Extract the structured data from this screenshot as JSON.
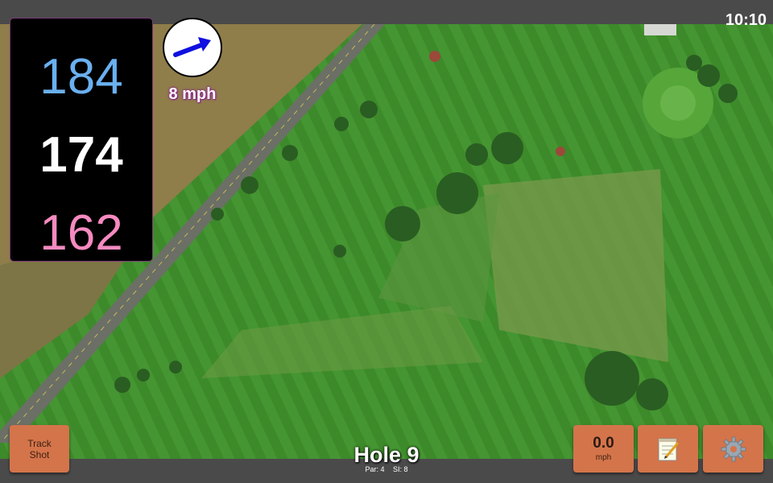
{
  "status_bar": {
    "time": "10:10"
  },
  "distances": {
    "back": "184",
    "middle": "174",
    "front": "162"
  },
  "wind": {
    "speed_label": "8 mph",
    "arrow_icon": "arrow-icon"
  },
  "hole": {
    "title": "Hole 9",
    "par_label": "Par: 4",
    "si_label": "SI: 8"
  },
  "buttons": {
    "track_shot": "Track\nShot",
    "speed_value": "0.0",
    "speed_unit": "mph",
    "notes_icon": "notepad-icon",
    "settings_icon": "gear-icon"
  },
  "colors": {
    "back": "#6ab0f0",
    "middle": "#ffffff",
    "front": "#f58ac0",
    "button": "#d4744a"
  }
}
